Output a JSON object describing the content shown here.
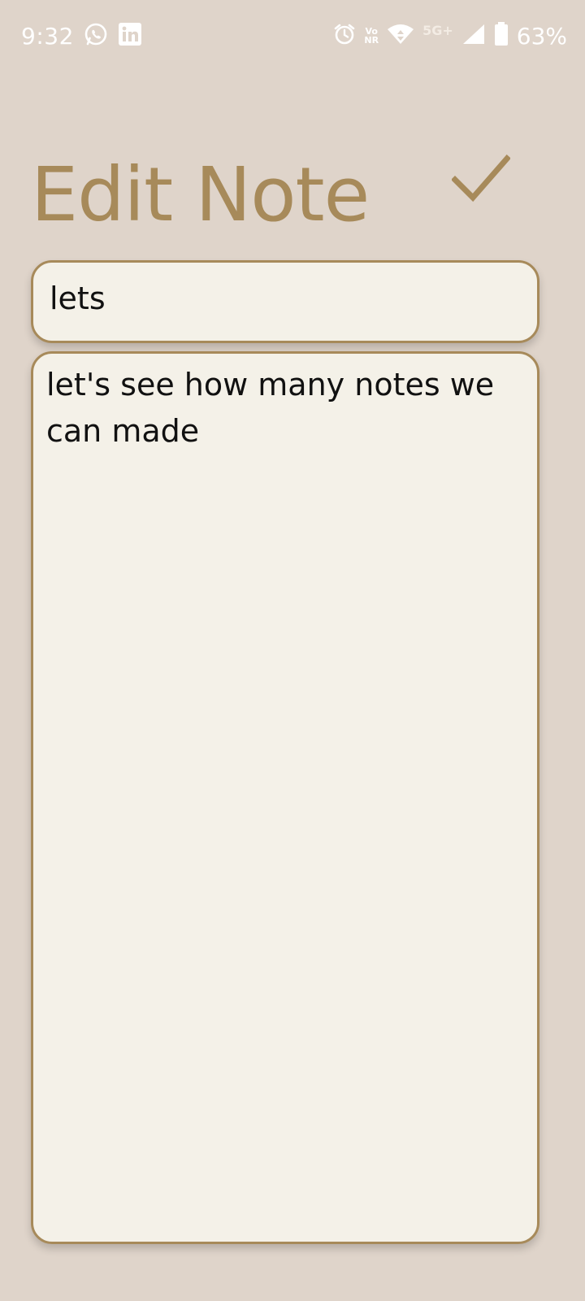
{
  "status_bar": {
    "time": "9:32",
    "left_icons": [
      "whatsapp-icon",
      "linkedin-icon"
    ],
    "right_icons": [
      "alarm-icon",
      "volte-icon",
      "wifi-icon",
      "5g-icon",
      "signal-icon",
      "battery-icon"
    ],
    "volte_top": "Vo",
    "volte_bottom": "NR",
    "network": "5G+",
    "battery": "63%"
  },
  "header": {
    "title": "Edit Note",
    "save_icon": "check-icon"
  },
  "note": {
    "title": "lets",
    "body": "let's see how many notes we can made"
  },
  "colors": {
    "background": "#dfd4ca",
    "accent": "#a78a5a",
    "field_bg": "#f4f1e8"
  }
}
